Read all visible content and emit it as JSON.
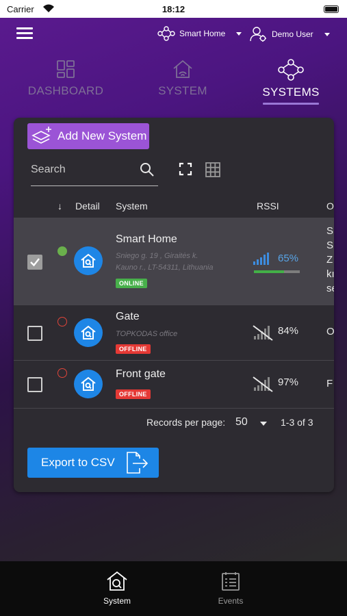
{
  "status_bar": {
    "carrier": "Carrier",
    "time": "18:12"
  },
  "header": {
    "location": {
      "label": "Smart Home",
      "icon": "network-icon"
    },
    "user": {
      "label": "Demo User",
      "icon": "user-gear-icon"
    }
  },
  "nav_tabs": [
    {
      "label": "DASHBOARD",
      "icon": "dashboard-grid-icon",
      "active": false
    },
    {
      "label": "SYSTEM",
      "icon": "home-wifi-icon",
      "active": false
    },
    {
      "label": "SYSTEMS",
      "icon": "network-icon",
      "active": true
    }
  ],
  "toolbar": {
    "add_label": "Add New System",
    "search_placeholder": "Search"
  },
  "table": {
    "columns": [
      "Detail",
      "System",
      "RSSI",
      "O"
    ],
    "rows": [
      {
        "selected": true,
        "status": "online",
        "name": "Smart Home",
        "address": "Sniego g. 19 , Giraitės k.\nKauno r., LT-54311, Lithuania",
        "badge": "ONLINE",
        "rssi": "65%",
        "rssi_level": 0.65,
        "other": "S\nS\nZ\nkı\nse"
      },
      {
        "selected": false,
        "status": "offline",
        "name": "Gate",
        "address": "TOPKODAS office",
        "badge": "OFFLINE",
        "rssi": "84%",
        "other": "O"
      },
      {
        "selected": false,
        "status": "offline",
        "name": "Front gate",
        "address": "",
        "badge": "OFFLINE",
        "rssi": "97%",
        "other": "F"
      }
    ]
  },
  "pagination": {
    "label": "Records per page:",
    "per_page": "50",
    "range": "1-3 of 3"
  },
  "export_label": "Export to CSV",
  "bottom_tabs": [
    {
      "label": "System",
      "icon": "home-search-icon",
      "active": true
    },
    {
      "label": "Events",
      "icon": "events-list-icon",
      "active": false
    }
  ],
  "colors": {
    "accent": "#9b54d6",
    "primary": "#1d86e6",
    "online": "#48b04b",
    "offline": "#e53935"
  }
}
